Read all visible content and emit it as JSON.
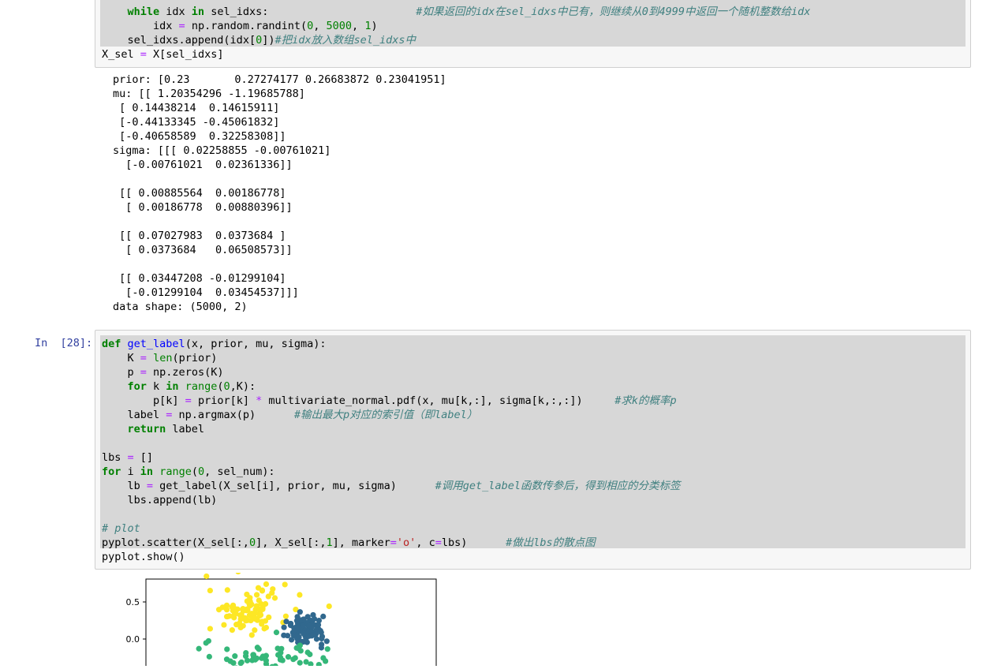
{
  "cell_top": {
    "lines": [
      {
        "indent": "    ",
        "partial": true,
        "segments": [
          [
            "kw",
            "while"
          ],
          [
            "t",
            " idx "
          ],
          [
            "kw",
            "in"
          ],
          [
            "t",
            " sel_idxs:"
          ]
        ],
        "comment": "#如果返回的idx在sel_idxs中已有，则继续从0到4999中返回一个随机整数给idx"
      },
      {
        "indent": "        ",
        "segments": [
          [
            "t",
            "idx "
          ],
          [
            "op",
            "="
          ],
          [
            "t",
            " np.random.randint("
          ],
          [
            "num",
            "0"
          ],
          [
            "t",
            ", "
          ],
          [
            "num",
            "5000"
          ],
          [
            "t",
            ", "
          ],
          [
            "num",
            "1"
          ],
          [
            "t",
            ")"
          ]
        ],
        "comment": ""
      },
      {
        "indent": "    ",
        "segments": [
          [
            "t",
            "sel_idxs.append(idx["
          ],
          [
            "num",
            "0"
          ],
          [
            "t",
            "])"
          ]
        ],
        "comment": "#把idx放入数组sel_idxs中"
      },
      {
        "indent": "",
        "segments": [
          [
            "t",
            "X_sel "
          ],
          [
            "op",
            "="
          ],
          [
            "t",
            " X[sel_idxs]"
          ]
        ],
        "comment": ""
      }
    ]
  },
  "output": {
    "lines": [
      "prior: [0.23       0.27274177 0.26683872 0.23041951]",
      "mu: [[ 1.20354296 -1.19685788]",
      " [ 0.14438214  0.14615911]",
      " [-0.44133345 -0.45061832]",
      " [-0.40658589  0.32258308]]",
      "sigma: [[[ 0.02258855 -0.00761021]",
      "  [-0.00761021  0.02361336]]",
      "",
      " [[ 0.00885564  0.00186778]",
      "  [ 0.00186778  0.00880396]]",
      "",
      " [[ 0.07027983  0.0373684 ]",
      "  [ 0.0373684   0.06508573]]",
      "",
      " [[ 0.03447208 -0.01299104]",
      "  [-0.01299104  0.03454537]]]",
      "data shape: (5000, 2)"
    ]
  },
  "cell_28": {
    "prompt": "In  [28]:",
    "lines": [
      {
        "segments": [
          [
            "kw",
            "def"
          ],
          [
            "t",
            " "
          ],
          [
            "fn",
            "get_label"
          ],
          [
            "t",
            "(x, prior, mu, sigma):"
          ]
        ],
        "comment": ""
      },
      {
        "segments": [
          [
            "t",
            "    K "
          ],
          [
            "op",
            "="
          ],
          [
            "t",
            " "
          ],
          [
            "bi",
            "len"
          ],
          [
            "t",
            "(prior)"
          ]
        ],
        "comment": ""
      },
      {
        "segments": [
          [
            "t",
            "    p "
          ],
          [
            "op",
            "="
          ],
          [
            "t",
            " np.zeros(K)"
          ]
        ],
        "comment": ""
      },
      {
        "segments": [
          [
            "t",
            "    "
          ],
          [
            "kw",
            "for"
          ],
          [
            "t",
            " k "
          ],
          [
            "kw",
            "in"
          ],
          [
            "t",
            " "
          ],
          [
            "bi",
            "range"
          ],
          [
            "t",
            "("
          ],
          [
            "num",
            "0"
          ],
          [
            "t",
            ",K):"
          ]
        ],
        "comment": ""
      },
      {
        "segments": [
          [
            "t",
            "        p[k] "
          ],
          [
            "op",
            "="
          ],
          [
            "t",
            " prior[k] "
          ],
          [
            "op",
            "*"
          ],
          [
            "t",
            " multivariate_normal.pdf(x, mu[k,:], sigma[k,:,:])     "
          ]
        ],
        "comment": "#求k的概率p"
      },
      {
        "segments": [
          [
            "t",
            "    label "
          ],
          [
            "op",
            "="
          ],
          [
            "t",
            " np.argmax(p)      "
          ]
        ],
        "comment": "#输出最大p对应的索引值（即label）"
      },
      {
        "segments": [
          [
            "t",
            "    "
          ],
          [
            "kw",
            "return"
          ],
          [
            "t",
            " label"
          ]
        ],
        "comment": ""
      },
      {
        "segments": [],
        "comment": ""
      },
      {
        "segments": [
          [
            "t",
            "lbs "
          ],
          [
            "op",
            "="
          ],
          [
            "t",
            " []"
          ]
        ],
        "comment": ""
      },
      {
        "segments": [
          [
            "kw",
            "for"
          ],
          [
            "t",
            " i "
          ],
          [
            "kw",
            "in"
          ],
          [
            "t",
            " "
          ],
          [
            "bi",
            "range"
          ],
          [
            "t",
            "("
          ],
          [
            "num",
            "0"
          ],
          [
            "t",
            ", sel_num):"
          ]
        ],
        "comment": ""
      },
      {
        "segments": [
          [
            "t",
            "    lb "
          ],
          [
            "op",
            "="
          ],
          [
            "t",
            " get_label(X_sel[i], prior, mu, sigma)      "
          ]
        ],
        "comment": "#调用get_label函数传参后，得到相应的分类标签"
      },
      {
        "segments": [
          [
            "t",
            "    lbs.append(lb)"
          ]
        ],
        "comment": ""
      },
      {
        "segments": [],
        "comment": ""
      },
      {
        "segments": [],
        "comment": "# plot"
      },
      {
        "segments": [
          [
            "t",
            "pyplot.scatter(X_sel[:,"
          ],
          [
            "num",
            "0"
          ],
          [
            "t",
            "], X_sel[:,"
          ],
          [
            "num",
            "1"
          ],
          [
            "t",
            "], marker"
          ],
          [
            "op",
            "="
          ],
          [
            "str",
            "'o'"
          ],
          [
            "t",
            ", c"
          ],
          [
            "op",
            "="
          ],
          [
            "t",
            "lbs)      "
          ]
        ],
        "comment": "#做出lbs的散点图"
      },
      {
        "segments": [
          [
            "t",
            "pyplot.show()"
          ]
        ],
        "comment": ""
      }
    ]
  },
  "chart_data": {
    "type": "scatter",
    "y_ticks": [
      "0.5",
      "0.0"
    ],
    "y_tick_values": [
      0.5,
      0.0
    ],
    "ylim_visible": [
      -0.35,
      0.76
    ],
    "xlim": [
      -1.55,
      1.55
    ],
    "colors": {
      "yellow": "#fde725",
      "blue": "#31688e",
      "green": "#35b779"
    },
    "clusters": [
      {
        "color": "yellow",
        "center": [
          -0.45,
          0.38
        ],
        "spread": [
          0.22,
          0.16
        ],
        "count": 95
      },
      {
        "color": "blue",
        "center": [
          0.15,
          0.12
        ],
        "spread": [
          0.1,
          0.1
        ],
        "count": 110
      },
      {
        "color": "green",
        "center": [
          -0.25,
          -0.28
        ],
        "spread": [
          0.35,
          0.12
        ],
        "count": 70
      }
    ]
  }
}
